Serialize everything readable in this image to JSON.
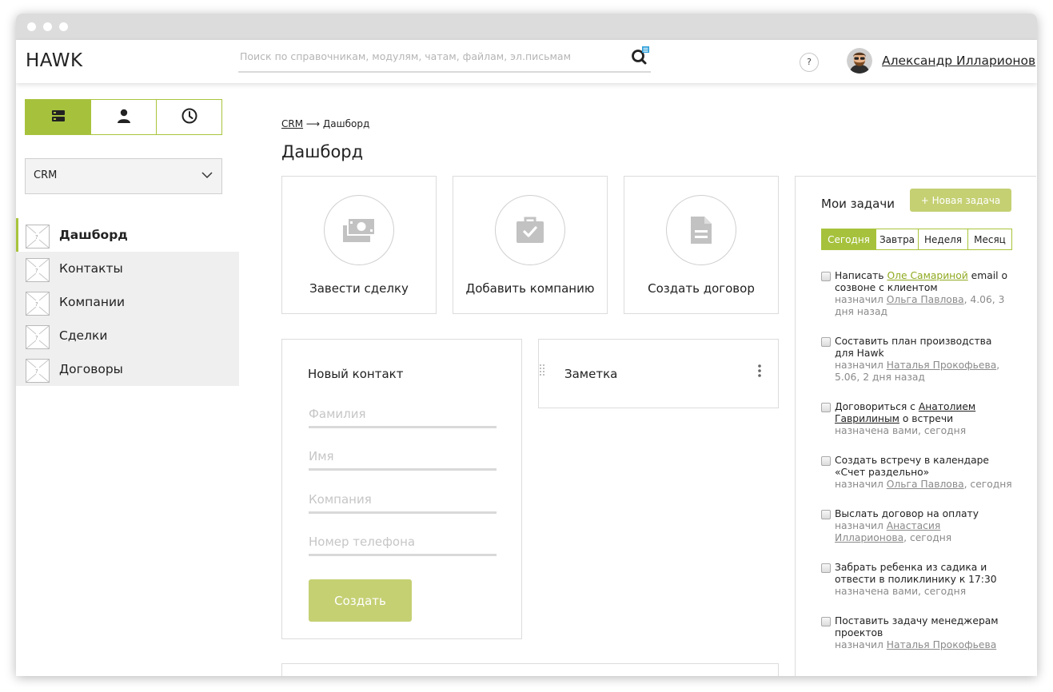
{
  "header": {
    "logo": "HAWK",
    "search_placeholder": "Поиск по справочникам, модулям, чатам, файлам, эл.письмам",
    "help_label": "?",
    "user_name": "Александр Илларионов"
  },
  "sidebar": {
    "mode_buttons": [
      "modules-icon",
      "user-icon",
      "clock-icon"
    ],
    "module_selected": "CRM",
    "items": [
      {
        "label": "Дашборд",
        "active": true
      },
      {
        "label": "Контакты"
      },
      {
        "label": "Компании"
      },
      {
        "label": "Сделки"
      },
      {
        "label": "Договоры"
      }
    ]
  },
  "breadcrumb": {
    "link": "CRM",
    "separator": " ⟶ ",
    "current": "Дашборд"
  },
  "page_title": "Дашборд",
  "quick_actions": [
    {
      "label": "Завести сделку",
      "icon": "money-icon"
    },
    {
      "label": "Добавить компанию",
      "icon": "briefcase-check-icon"
    },
    {
      "label": "Создать договор",
      "icon": "document-icon"
    }
  ],
  "contact_form": {
    "title": "Новый контакт",
    "fields": [
      "Фамилия",
      "Имя",
      "Компания",
      "Номер телефона"
    ],
    "submit": "Создать"
  },
  "note": {
    "title": "Заметка"
  },
  "tasks": {
    "title": "Мои задачи",
    "new_button": "+ Новая задача",
    "tabs": [
      "Сегодня",
      "Завтра",
      "Неделя",
      "Месяц"
    ],
    "active_tab": "Сегодня",
    "items": [
      {
        "t1": "Написать ",
        "link": "Оле Самариной",
        "t2": " email о созвоне с клиентом",
        "m1": "назначил ",
        "mlink": "Ольга Павлова",
        "m2": ", 4.06, 3 дня назад"
      },
      {
        "t1": "Составить план производства для Hawk",
        "link": "",
        "t2": "",
        "m1": "назначил ",
        "mlink": "Наталья Прокофьева",
        "m2": ", 5.06, 2 дня назад"
      },
      {
        "t1": "Договориться с ",
        "link": "Анатолием Гаврилиным",
        "t2": " о встречи",
        "m1": "назначена вами, сегодня",
        "mlink": "",
        "m2": ""
      },
      {
        "t1": "Создать встречу в календаре «Счет раздельно»",
        "link": "",
        "t2": "",
        "m1": "назначил ",
        "mlink": "Ольга Павлова",
        "m2": ", сегодня"
      },
      {
        "t1": "Выслать договор на оплату",
        "link": "",
        "t2": "",
        "m1": "назначил ",
        "mlink": "Анастасия Илларионова",
        "m2": ", сегодня"
      },
      {
        "t1": "Забрать ребенка из садика и отвести в поликлинику к 17:30",
        "link": "",
        "t2": "",
        "m1": "назначена вами, сегодня",
        "mlink": "",
        "m2": ""
      },
      {
        "t1": "Поставить задачу менеджерам проектов",
        "link": "",
        "t2": "",
        "m1": "назначил ",
        "mlink": "Наталья Прокофьева",
        "m2": ""
      }
    ]
  },
  "colors": {
    "accent": "#a6c23d",
    "accent_light": "#c5d073",
    "border": "#dcdcdc",
    "muted": "#8a8a8a"
  }
}
